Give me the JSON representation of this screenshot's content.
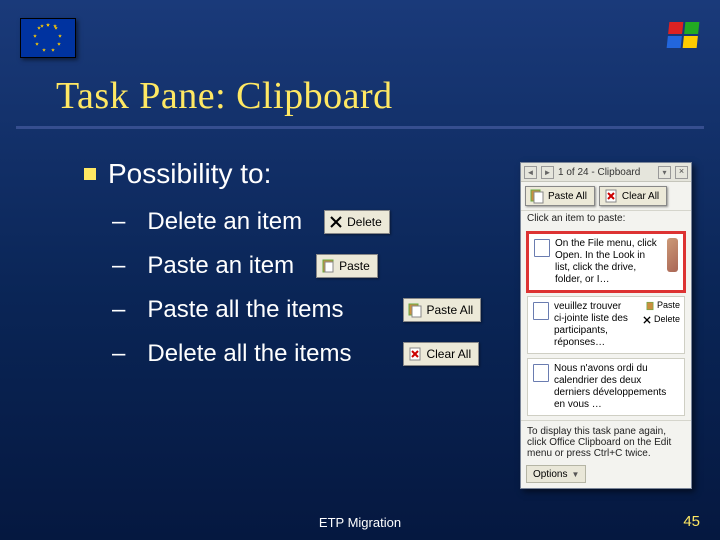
{
  "title": "Task Pane: Clipboard",
  "bullet_main": "Possibility to:",
  "subs": {
    "delete_item": "Delete an item",
    "paste_item": "Paste an item",
    "paste_all": "Paste all the items",
    "delete_all": "Delete all the items"
  },
  "buttons": {
    "delete": "Delete",
    "paste": "Paste",
    "paste_all": "Paste All",
    "clear_all": "Clear All"
  },
  "pane": {
    "header": "1 of 24 - Clipboard",
    "hint": "Click an item to paste:",
    "item1": "On the File menu, click Open. In the Look in list, click the drive, folder, or I…",
    "item2": "veuillez trouver ci-jointe liste des participants, réponses…",
    "mini_paste": "Paste",
    "mini_delete": "Delete",
    "item3": "Nous n'avons ordi du calendrier des deux derniers développements en vous …",
    "footer_hint": "To display this task pane again, click Office Clipboard on the Edit menu or press Ctrl+C twice.",
    "options": "Options"
  },
  "footer": "ETP Migration",
  "page_number": "45"
}
